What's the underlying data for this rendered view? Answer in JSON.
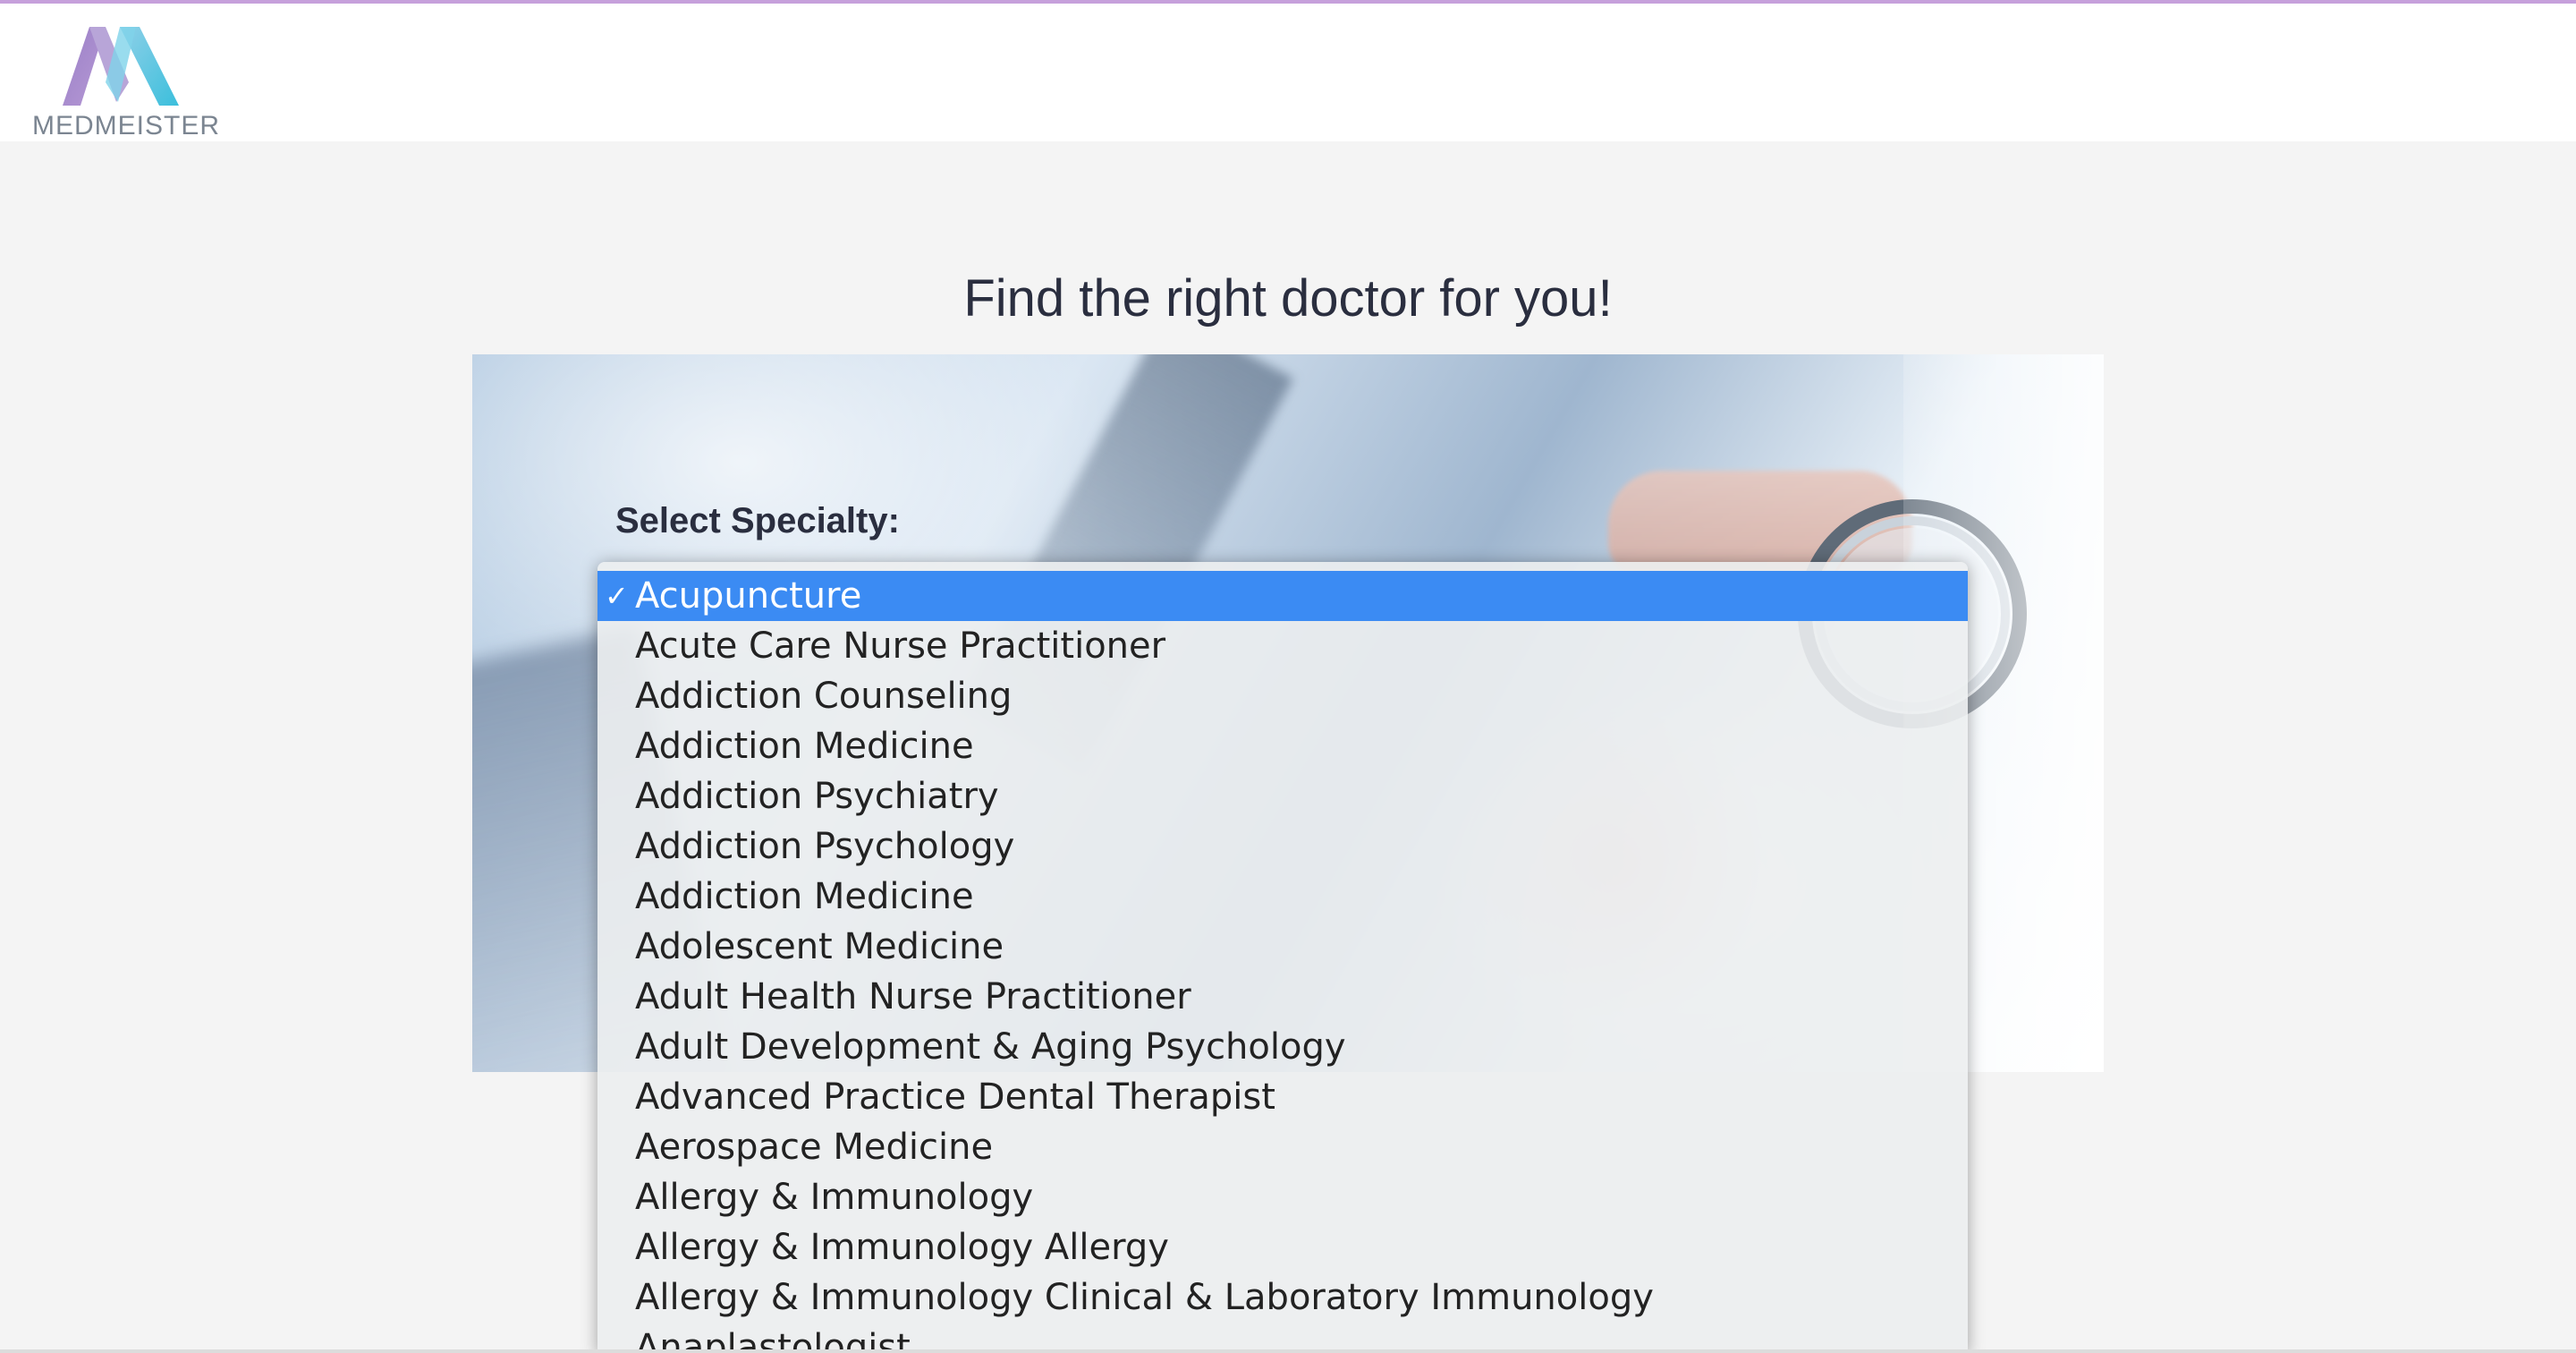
{
  "header": {
    "logo_text": "MEDMEISTER",
    "accent_color": "#c6a0db"
  },
  "main": {
    "title": "Find the right doctor for you!",
    "specialty_label": "Select Specialty:",
    "check_glyph": "✓",
    "selected_index": 0,
    "options": [
      "Acupuncture",
      "Acute Care Nurse Practitioner",
      "Addiction Counseling",
      "Addiction Medicine",
      "Addiction Psychiatry",
      "Addiction Psychology",
      "Addiction Medicine",
      "Adolescent Medicine",
      "Adult Health Nurse Practitioner",
      "Adult Development & Aging Psychology",
      "Advanced Practice Dental Therapist",
      "Aerospace Medicine",
      "Allergy & Immunology",
      "Allergy & Immunology Allergy",
      "Allergy & Immunology Clinical & Laboratory Immunology",
      "Anaplastologist"
    ],
    "selection_color": "#3b8bf3"
  }
}
